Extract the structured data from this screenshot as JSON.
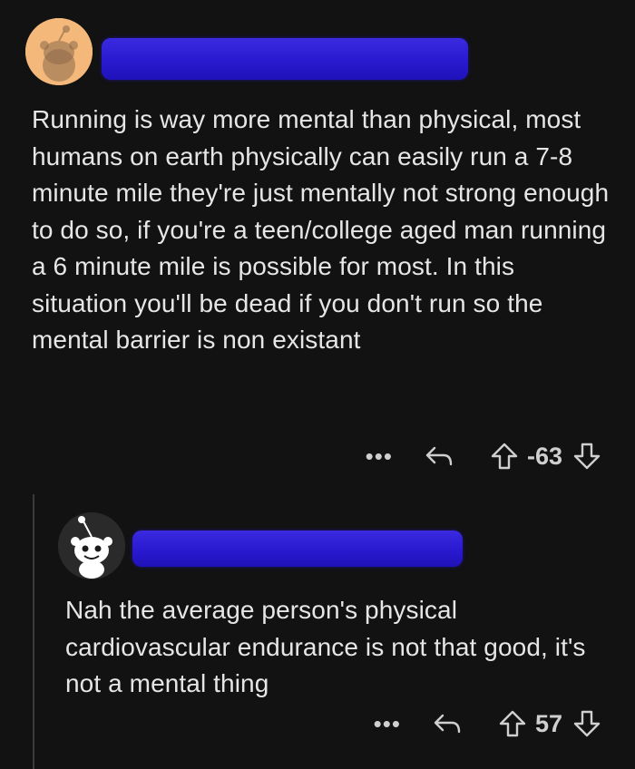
{
  "comments": [
    {
      "body": "Running is way more mental than physical, most humans on earth physically can easily run a 7-8 minute mile they're just mentally not strong enough to do so, if you're a teen/college aged man running a 6 minute mile is possible for most. In this situation you'll be dead if you don't run so the mental barrier is non existant",
      "more": "•••",
      "score": "-63",
      "avatar_color": "#f4b87a"
    },
    {
      "body": "Nah the average person's physical cardiovascular endurance is not that good, it's not a mental thing",
      "more": "•••",
      "score": "57",
      "avatar_color": "#2a2a2a"
    }
  ],
  "theme": {
    "background": "#121212",
    "redaction": "#2a1bd2",
    "text": "#e6e6e6"
  },
  "icons": [
    "reply-arrow-icon",
    "upvote-arrow-icon",
    "downvote-arrow-icon",
    "more-options-icon"
  ]
}
